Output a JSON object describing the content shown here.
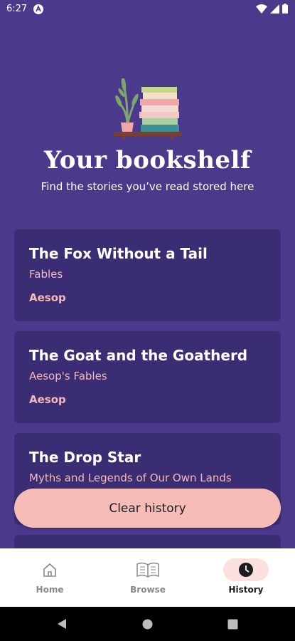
{
  "status_bar": {
    "time": "6:27"
  },
  "header": {
    "title": "Your bookshelf",
    "subtitle": "Find the stories you’ve read stored here"
  },
  "stories": [
    {
      "title": "The Fox Without a Tail",
      "collection": "Fables",
      "author": "Aesop"
    },
    {
      "title": "The Goat and the Goatherd",
      "collection": "Aesop's Fables",
      "author": "Aesop"
    },
    {
      "title": "The Drop Star",
      "collection": "Myths and Legends of Our Own Lands",
      "author": ""
    }
  ],
  "clear_button": {
    "label": "Clear history"
  },
  "bottom_nav": {
    "items": [
      {
        "label": "Home",
        "icon": "home-icon",
        "active": false
      },
      {
        "label": "Browse",
        "icon": "book-icon",
        "active": false
      },
      {
        "label": "History",
        "icon": "clock-icon",
        "active": true
      }
    ]
  },
  "colors": {
    "background": "#4b3a8c",
    "card": "#3b2d73",
    "accent": "#f6bcb8",
    "accent_text": "#f5b9b5"
  }
}
